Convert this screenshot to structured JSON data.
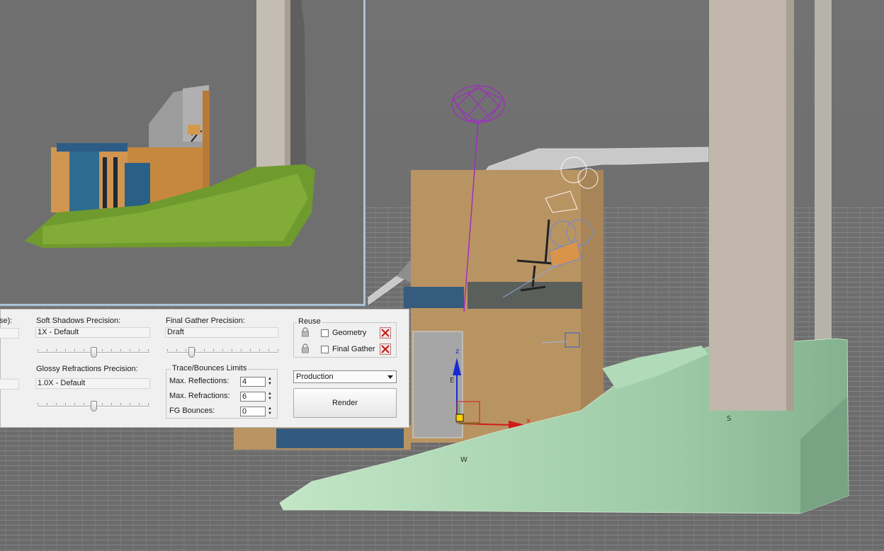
{
  "panel": {
    "cut_label": "se):",
    "soft_shadows": {
      "label": "Soft Shadows Precision:",
      "value": "1X - Default",
      "level": 0.5
    },
    "glossy_refractions": {
      "label": "Glossy Refractions Precision:",
      "value": "1.0X - Default",
      "level": 0.5
    },
    "final_gather": {
      "label": "Final Gather Precision:",
      "value": "Draft",
      "level": 0.2
    },
    "trace_limits": {
      "title": "Trace/Bounces Limits",
      "max_reflections": {
        "label": "Max. Reflections:",
        "value": "4"
      },
      "max_refractions": {
        "label": "Max. Refractions:",
        "value": "6"
      },
      "fg_bounces": {
        "label": "FG Bounces:",
        "value": "0"
      }
    },
    "reuse": {
      "title": "Reuse",
      "geometry_label": "Geometry",
      "final_gather_label": "Final Gather"
    },
    "preset": {
      "selected": "Production"
    },
    "render_button": "Render"
  },
  "viewport": {
    "axis_x": "x",
    "axis_z": "z",
    "dir_e": "E",
    "dir_w": "W",
    "dir_s": "S"
  },
  "colors": {
    "panel_bg": "#f0f0f0",
    "terrain_green": "#a4d2ae",
    "gizmo_purple": "#a02cc2",
    "axis_red": "#d11a1a",
    "axis_blue": "#1a2ad1"
  }
}
